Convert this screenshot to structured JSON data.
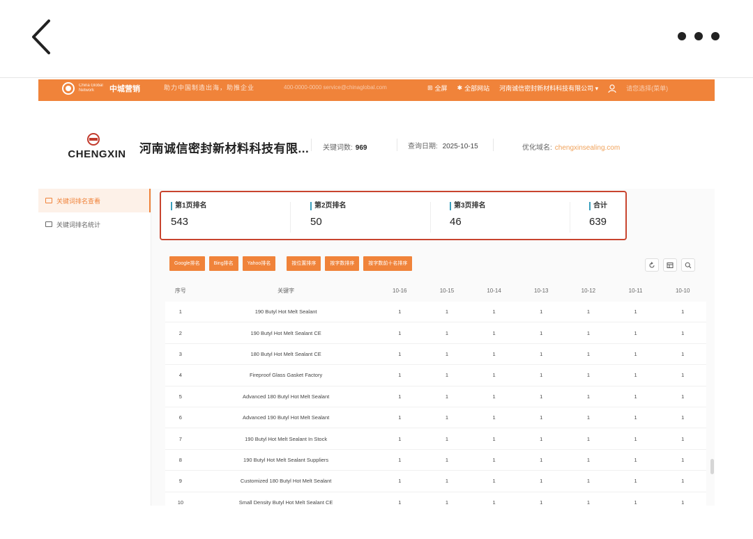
{
  "header": {
    "brand_small": "China Global Network",
    "brand_name": "中城营销",
    "slogan": "助力中国制造出海，助推企业",
    "contact": "400-0000-0000  service@chinaglobal.com",
    "nav": [
      {
        "icon": "grid-icon",
        "label": "全屏"
      },
      {
        "icon": "star-icon",
        "label": "全部网站"
      },
      {
        "icon": "company-dropdown",
        "label": "河南诚信密封新材料科技有限公司 ▾"
      }
    ],
    "user_label": "请您选择(菜单)"
  },
  "company": {
    "logo_text": "CHENGXIN",
    "name": "河南诚信密封新材料科技有限...",
    "keyword_count_label": "关键词数:",
    "keyword_count": "969",
    "query_date_label": "查询日期:",
    "query_date": "2025-10-15",
    "domain_label": "优化域名:",
    "domain": "chengxinsealing.com"
  },
  "sidebar": {
    "items": [
      {
        "label": "关键词排名查看",
        "active": true
      },
      {
        "label": "关键词排名统计",
        "active": false
      }
    ]
  },
  "summary": [
    {
      "label": "第1页排名",
      "value": "543"
    },
    {
      "label": "第2页排名",
      "value": "50"
    },
    {
      "label": "第3页排名",
      "value": "46"
    },
    {
      "label": "合计",
      "value": "639"
    }
  ],
  "toolbar": {
    "buttons": [
      "Google排名",
      "Bing排名",
      "Yahoo排名",
      "按位置排序",
      "按字数排序",
      "按字数前十名排序"
    ]
  },
  "table": {
    "headers": [
      "序号",
      "关键字",
      "10-16",
      "10-15",
      "10-14",
      "10-13",
      "10-12",
      "10-11",
      "10-10"
    ],
    "rows": [
      [
        "1",
        "190 Butyl Hot Melt Sealant",
        "1",
        "1",
        "1",
        "1",
        "1",
        "1",
        "1"
      ],
      [
        "2",
        "190 Butyl Hot Melt Sealant CE",
        "1",
        "1",
        "1",
        "1",
        "1",
        "1",
        "1"
      ],
      [
        "3",
        "180 Butyl Hot Melt Sealant CE",
        "1",
        "1",
        "1",
        "1",
        "1",
        "1",
        "1"
      ],
      [
        "4",
        "Fireproof Glass Gasket Factory",
        "1",
        "1",
        "1",
        "1",
        "1",
        "1",
        "1"
      ],
      [
        "5",
        "Advanced 180 Butyl Hot Melt Sealant",
        "1",
        "1",
        "1",
        "1",
        "1",
        "1",
        "1"
      ],
      [
        "6",
        "Advanced 190 Butyl Hot Melt Sealant",
        "1",
        "1",
        "1",
        "1",
        "1",
        "1",
        "1"
      ],
      [
        "7",
        "190 Butyl Hot Melt Sealant In Stock",
        "1",
        "1",
        "1",
        "1",
        "1",
        "1",
        "1"
      ],
      [
        "8",
        "190 Butyl Hot Melt Sealant Suppliers",
        "1",
        "1",
        "1",
        "1",
        "1",
        "1",
        "1"
      ],
      [
        "9",
        "Customized 180 Butyl Hot Melt Sealant",
        "1",
        "1",
        "1",
        "1",
        "1",
        "1",
        "1"
      ],
      [
        "10",
        "Small Density Butyl Hot Melt Sealant CE",
        "1",
        "1",
        "1",
        "1",
        "1",
        "1",
        "1"
      ]
    ]
  },
  "colors": {
    "accent": "#f0833a",
    "summary_border": "#c8442e",
    "label_bar": "#3a9fbd"
  }
}
